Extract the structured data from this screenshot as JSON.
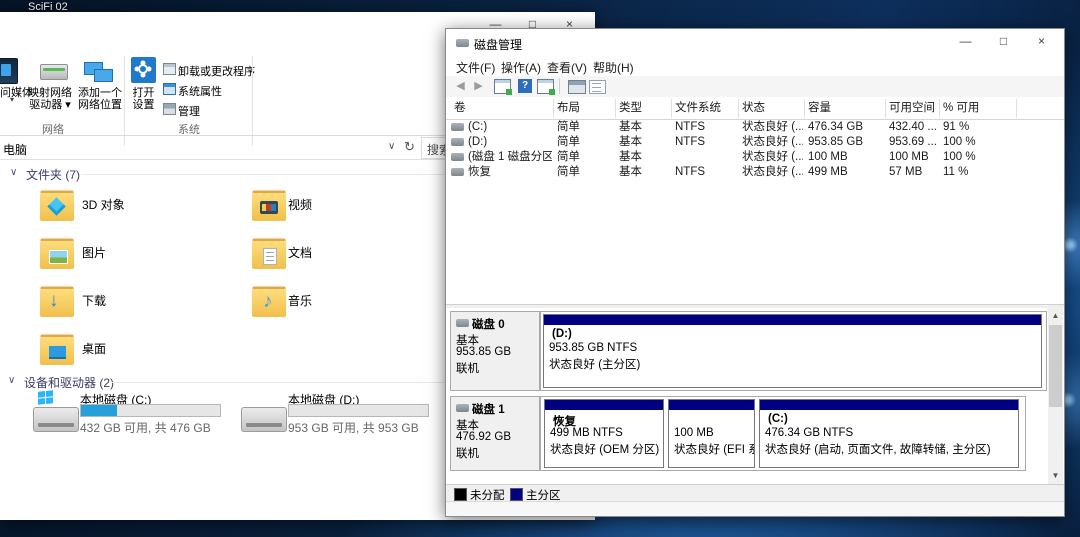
{
  "desktop": {
    "icon_label": "SciFi 02"
  },
  "explorer": {
    "caption": {
      "minimize": "—",
      "maximize": "□",
      "close": "×"
    },
    "ribbon": {
      "media": {
        "label": "问媒体",
        "arrow": "▾"
      },
      "map_drive": {
        "line1": "映射网络",
        "line2": "驱动器 ▾"
      },
      "add_network": {
        "line1": "添加一个",
        "line2": "网络位置"
      },
      "open_settings": {
        "line1": "打开",
        "line2": "设置"
      },
      "uninstall": "卸载或更改程序",
      "system_props": "系统属性",
      "manage": "管理",
      "group_network": "网络",
      "group_system": "系统"
    },
    "address": {
      "path": "电脑",
      "chevron": "∨",
      "refresh": "↻",
      "search": "搜索"
    },
    "sections": {
      "chevron": "∨",
      "folders_title": "文件夹 (7)",
      "devices_title": "设备和驱动器 (2)"
    },
    "folders": [
      {
        "label": "3D 对象"
      },
      {
        "label": "视频"
      },
      {
        "label": "图片"
      },
      {
        "label": "文档"
      },
      {
        "label": "下载"
      },
      {
        "label": "音乐"
      },
      {
        "label": "桌面"
      }
    ],
    "drives": [
      {
        "label": "本地磁盘 (C:)",
        "detail": "432 GB 可用, 共 476 GB",
        "usage_pct": 26
      },
      {
        "label": "本地磁盘 (D:)",
        "detail": "953 GB 可用, 共 953 GB",
        "usage_pct": 0
      }
    ]
  },
  "diskmgmt": {
    "title": "磁盘管理",
    "caption": {
      "minimize": "—",
      "maximize": "□",
      "close": "×"
    },
    "menus": [
      "文件(F)",
      "操作(A)",
      "查看(V)",
      "帮助(H)"
    ],
    "columns": [
      "卷",
      "布局",
      "类型",
      "文件系统",
      "状态",
      "容量",
      "可用空间",
      "% 可用"
    ],
    "rows": [
      [
        "(C:)",
        "简单",
        "基本",
        "NTFS",
        "状态良好 (...",
        "476.34 GB",
        "432.40 ...",
        "91 %"
      ],
      [
        "(D:)",
        "简单",
        "基本",
        "NTFS",
        "状态良好 (...",
        "953.85 GB",
        "953.69 ...",
        "100 %"
      ],
      [
        "(磁盘 1 磁盘分区 2)",
        "简单",
        "基本",
        "",
        "状态良好 (...",
        "100 MB",
        "100 MB",
        "100 %"
      ],
      [
        "恢复",
        "简单",
        "基本",
        "NTFS",
        "状态良好 (...",
        "499 MB",
        "57 MB",
        "11 %"
      ]
    ],
    "disks": [
      {
        "name": "磁盘 0",
        "kind": "基本",
        "size": "953.85 GB",
        "status": "联机",
        "partitions": [
          {
            "title": "(D:)",
            "line2": "953.85 GB NTFS",
            "line3": "状态良好 (主分区)"
          }
        ]
      },
      {
        "name": "磁盘 1",
        "kind": "基本",
        "size": "476.92 GB",
        "status": "联机",
        "partitions": [
          {
            "title": "恢复",
            "line2": "499 MB NTFS",
            "line3": "状态良好 (OEM 分区)"
          },
          {
            "title": "",
            "line2": "100 MB",
            "line3": "状态良好 (EFI 系统"
          },
          {
            "title": "(C:)",
            "line2": "476.34 GB NTFS",
            "line3": "状态良好 (启动, 页面文件, 故障转储, 主分区)"
          }
        ]
      }
    ],
    "legend": [
      {
        "label": "未分配",
        "color": "#000000"
      },
      {
        "label": "主分区",
        "color": "#000080"
      }
    ],
    "partition_bar_color": "#000080"
  }
}
